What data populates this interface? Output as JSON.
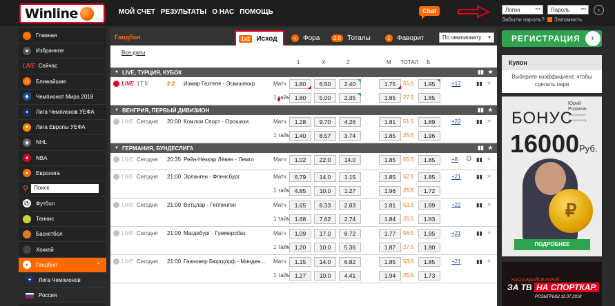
{
  "header": {
    "logo_text": "Winline",
    "nav": [
      "МОЙ СЧЕТ",
      "РЕЗУЛЬТАТЫ",
      "О НАС",
      "ПОМОЩЬ"
    ],
    "chat_label": "Chat",
    "login_placeholder": "Логин",
    "password_placeholder": "Пароль",
    "forgot_password": "Забыли пароль?",
    "remember_me": "Запомнить"
  },
  "sidebar": {
    "items": [
      {
        "label": "Главная",
        "icon": "home-icon",
        "color": "#ff6a00"
      },
      {
        "label": "Избранное",
        "icon": "star-icon",
        "color": "#555555"
      },
      {
        "label": "Сейчас",
        "icon": "live-icon",
        "live_tag": "LIVE"
      },
      {
        "label": "Ближайшие",
        "icon": "clock-icon",
        "color": "#ff6a00"
      },
      {
        "label": "Чемпионат Мира 2018",
        "icon": "worldcup-icon",
        "color": "#1b4ea3"
      },
      {
        "label": "Лига Чемпионов УЕФА",
        "icon": "ucl-icon",
        "color": "#1b2f6e"
      },
      {
        "label": "Лига Европы УЕФА",
        "icon": "uel-icon",
        "color": "#ff8a00"
      },
      {
        "label": "NHL",
        "icon": "nhl-icon",
        "color": "#666666"
      },
      {
        "label": "NBA",
        "icon": "nba-icon",
        "color": "#c9082a"
      },
      {
        "label": "Евролига",
        "icon": "euroleague-icon",
        "color": "#ff6a00"
      }
    ],
    "search_label": "Поиск",
    "sports": [
      {
        "label": "Футбол",
        "icon": "football-icon",
        "color": "#ffffff"
      },
      {
        "label": "Теннис",
        "icon": "tennis-icon",
        "color": "#c9d12a"
      },
      {
        "label": "Баскетбол",
        "icon": "basketball-icon",
        "color": "#e07a1b"
      },
      {
        "label": "Хоккей",
        "icon": "hockey-icon",
        "color": "#444444"
      },
      {
        "label": "Гандбол",
        "icon": "handball-icon",
        "color": "#ffffff",
        "active": true
      }
    ],
    "sub_items": [
      {
        "label": "Лига Чемпионов",
        "icon": "ucl-icon"
      },
      {
        "label": "Россия",
        "icon": "russia-flag-icon"
      }
    ]
  },
  "main": {
    "sport_title": "Гандбол",
    "tabs": [
      {
        "badge": "1x2",
        "label": "Исход",
        "selected": true
      },
      {
        "badge": "+",
        "label": "Фора"
      },
      {
        "badge": "2.5",
        "label": "Тоталы"
      },
      {
        "badge": "1",
        "label": "Фаворит"
      }
    ],
    "sort_select": "По чемпионату",
    "all_dates": "Все даты",
    "col_headers": [
      "1",
      "X",
      "2",
      "М",
      "ТОТАЛ",
      "Б"
    ],
    "sections": [
      {
        "title": "LIVE, ТУРЦИЯ, КУБОК",
        "matches": [
          {
            "status": "LIVE",
            "is_live": true,
            "time_a": "1Т 5'",
            "time_b": "2:2",
            "teams": "Измир Гезтепе - Эскишехир",
            "more": "+17",
            "rows": [
              {
                "period": "Матч",
                "o1": "1.80",
                "ox": "6.50",
                "o2": "2.40",
                "m": "1.75",
                "total": "55.5",
                "b": "1.95",
                "o1_arrow": "down",
                "o2_arrow": "up",
                "m_arrow": "down",
                "b_arrow": "up"
              },
              {
                "period": "1 тайм",
                "o1": "1.80",
                "ox": "5.00",
                "o2": "2.35",
                "m": "1.85",
                "total": "27.5",
                "b": "1.85",
                "o2_arrow": "up"
              }
            ]
          }
        ]
      },
      {
        "title": "ВЕНГРИЯ, ПЕРВЫЙ ДИВИЗИОН",
        "matches": [
          {
            "status": "LIVE",
            "time_a": "Сегодня",
            "time_b": "20:00",
            "teams": "Комлои Спорт - Орошази",
            "more": "+22",
            "rows": [
              {
                "period": "Матч",
                "o1": "1.28",
                "ox": "9.70",
                "o2": "4.26",
                "m": "1.81",
                "total": "51.5",
                "b": "1.89"
              },
              {
                "period": "1 тайм",
                "o1": "1.40",
                "ox": "8.57",
                "o2": "3.74",
                "m": "1.85",
                "total": "25.5",
                "b": "1.96"
              }
            ]
          }
        ]
      },
      {
        "title": "ГЕРМАНИЯ, БУНДЕСЛИГА",
        "matches": [
          {
            "status": "LIVE",
            "time_a": "Сегодня",
            "time_b": "20:35",
            "teams": "Рейн-Неккар Лёвен - Лемго",
            "more": "+8",
            "has_stream": true,
            "rows": [
              {
                "period": "Матч",
                "o1": "1.02",
                "ox": "22.0",
                "o2": "14.0",
                "m": "1.85",
                "total": "55.5",
                "b": "1.85"
              }
            ]
          },
          {
            "status": "LIVE",
            "time_a": "Сегодня",
            "time_b": "21:00",
            "teams": "Эрланген - Фленсбург",
            "more": "+21",
            "rows": [
              {
                "period": "Матч",
                "o1": "6.79",
                "ox": "14.0",
                "o2": "1.15",
                "m": "1.85",
                "total": "52.5",
                "b": "1.85"
              },
              {
                "period": "1 тайм",
                "o1": "4.85",
                "ox": "10.0",
                "o2": "1.27",
                "m": "1.96",
                "total": "25.5",
                "b": "1.72"
              }
            ]
          },
          {
            "status": "LIVE",
            "time_a": "Сегодня",
            "time_b": "21:00",
            "teams": "Ветцлар - Геппинген",
            "more": "+22",
            "rows": [
              {
                "period": "Матч",
                "o1": "1.65",
                "ox": "8.33",
                "o2": "2.83",
                "m": "1.81",
                "total": "53.5",
                "b": "1.89"
              },
              {
                "period": "1 тайм",
                "o1": "1.68",
                "ox": "7.62",
                "o2": "2.74",
                "m": "1.84",
                "total": "25.5",
                "b": "1.83"
              }
            ]
          },
          {
            "status": "LIVE",
            "time_a": "Сегодня",
            "time_b": "21:00",
            "teams": "Магдебург - Гуммерсбах",
            "more": "+21",
            "rows": [
              {
                "period": "Матч",
                "o1": "1.09",
                "ox": "17.0",
                "o2": "8.72",
                "m": "1.77",
                "total": "56.5",
                "b": "1.95"
              },
              {
                "period": "1 тайм",
                "o1": "1.20",
                "ox": "10.0",
                "o2": "5.36",
                "m": "1.87",
                "total": "27.5",
                "b": "1.80"
              }
            ]
          },
          {
            "status": "LIVE",
            "time_a": "Сегодня",
            "time_b": "21:00",
            "teams": "Ганновер Бюргдорф - Минден...",
            "more": "+21",
            "rows": [
              {
                "period": "Матч",
                "o1": "1.15",
                "ox": "14.0",
                "o2": "6.82",
                "m": "1.85",
                "total": "53.5",
                "b": "1.85"
              },
              {
                "period": "1 тайм",
                "o1": "1.27",
                "ox": "10.0",
                "o2": "4.41",
                "m": "1.94",
                "total": "25.5",
                "b": "1.73"
              }
            ]
          }
        ]
      }
    ]
  },
  "right": {
    "register_label": "РЕГИСТРАЦИЯ",
    "coupon_title": "Купон",
    "coupon_text": "Выберите коэффициент, чтобы сделать пари",
    "banner": {
      "name_line1": "Юрий",
      "name_line2": "Розанов",
      "name_caption": "спортивный комментатор",
      "bonus": "БОНУС",
      "amount": "16000",
      "currency": "Руб.",
      "coin_symbol": "₽",
      "button": "ПОДРОБНЕЕ"
    },
    "banner2": {
      "sub": "НАСЛАЖДАЙСЯ ИГРОЙ",
      "main_a": "ЗА ТВ",
      "main_b": "НА СПОРТКАР.",
      "date": "РОЗЫГРЫШ 12.07.2018"
    }
  },
  "colors": {
    "accent": "#ff6a00",
    "green": "#2ea44f",
    "red": "#e0001b",
    "header_bg": "#1e1e1e"
  }
}
